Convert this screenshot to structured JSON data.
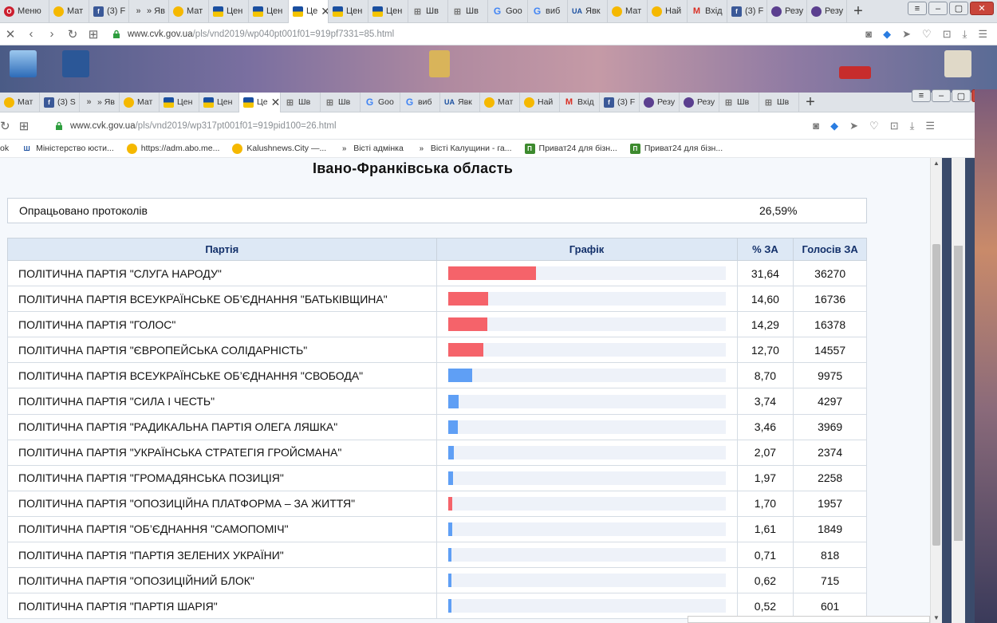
{
  "back_window": {
    "tabs": [
      {
        "label": "Меню",
        "icon": "opera-icon",
        "color": "#cc1f2f"
      },
      {
        "label": "Мат",
        "icon": "yellow-circle-icon",
        "color": "#f5b800"
      },
      {
        "label": "(3) F",
        "icon": "facebook-icon",
        "color": "#3b5998"
      },
      {
        "label": "» Яв",
        "icon": "page-icon",
        "color": "#666666"
      },
      {
        "label": "Мат",
        "icon": "yellow-circle-icon",
        "color": "#f5b800"
      },
      {
        "label": "Цен",
        "icon": "cvk-flag-icon",
        "color": "#1a4fa0"
      },
      {
        "label": "Цен",
        "icon": "cvk-flag-icon",
        "color": "#1a4fa0"
      },
      {
        "label": "Це",
        "icon": "cvk-flag-icon",
        "color": "#1a4fa0",
        "active": true
      },
      {
        "label": "Цен",
        "icon": "cvk-flag-icon",
        "color": "#1a4fa0"
      },
      {
        "label": "Цен",
        "icon": "cvk-flag-icon",
        "color": "#1a4fa0"
      },
      {
        "label": "Шв",
        "icon": "grid-icon",
        "color": "#777777"
      },
      {
        "label": "Шв",
        "icon": "grid-icon",
        "color": "#777777"
      },
      {
        "label": "Goo",
        "icon": "google-icon",
        "color": "#4285f4"
      },
      {
        "label": "виб",
        "icon": "google-icon",
        "color": "#4285f4"
      },
      {
        "label": "Явк",
        "icon": "ua-icon",
        "color": "#1a4fa0"
      },
      {
        "label": "Мат",
        "icon": "yellow-circle-icon",
        "color": "#f5b800"
      },
      {
        "label": "Най",
        "icon": "yellow-circle-icon",
        "color": "#f5b800"
      },
      {
        "label": "Вхід",
        "icon": "gmail-icon",
        "color": "#d93025"
      },
      {
        "label": "(3) F",
        "icon": "facebook-icon",
        "color": "#3b5998"
      },
      {
        "label": "Резу",
        "icon": "purple-circle-icon",
        "color": "#5b3f8f"
      },
      {
        "label": "Резу",
        "icon": "purple-circle-icon",
        "color": "#5b3f8f"
      }
    ],
    "url_host": "www.cvk.gov.ua",
    "url_path": "/pls/vnd2019/wp040pt001f01=919pf7331=85.html"
  },
  "front_window": {
    "tabs": [
      {
        "label": "Мат",
        "icon": "yellow-circle-icon",
        "color": "#f5b800"
      },
      {
        "label": "(3) S",
        "icon": "facebook-icon",
        "color": "#3b5998"
      },
      {
        "label": "» Яв",
        "icon": "page-icon",
        "color": "#666666"
      },
      {
        "label": "Мат",
        "icon": "yellow-circle-icon",
        "color": "#f5b800"
      },
      {
        "label": "Цен",
        "icon": "cvk-flag-icon",
        "color": "#1a4fa0"
      },
      {
        "label": "Цен",
        "icon": "cvk-flag-icon",
        "color": "#1a4fa0"
      },
      {
        "label": "Це",
        "icon": "cvk-flag-icon",
        "color": "#1a4fa0",
        "active": true
      },
      {
        "label": "Шв",
        "icon": "grid-icon",
        "color": "#777777"
      },
      {
        "label": "Шв",
        "icon": "grid-icon",
        "color": "#777777"
      },
      {
        "label": "Goo",
        "icon": "google-icon",
        "color": "#4285f4"
      },
      {
        "label": "виб",
        "icon": "google-icon",
        "color": "#4285f4"
      },
      {
        "label": "Явк",
        "icon": "ua-icon",
        "color": "#1a4fa0"
      },
      {
        "label": "Мат",
        "icon": "yellow-circle-icon",
        "color": "#f5b800"
      },
      {
        "label": "Най",
        "icon": "yellow-circle-icon",
        "color": "#f5b800"
      },
      {
        "label": "Вхід",
        "icon": "gmail-icon",
        "color": "#d93025"
      },
      {
        "label": "(3) F",
        "icon": "facebook-icon",
        "color": "#3b5998"
      },
      {
        "label": "Резу",
        "icon": "purple-circle-icon",
        "color": "#5b3f8f"
      },
      {
        "label": "Резу",
        "icon": "purple-circle-icon",
        "color": "#5b3f8f"
      },
      {
        "label": "Шв",
        "icon": "grid-icon",
        "color": "#777777"
      },
      {
        "label": "Шв",
        "icon": "grid-icon",
        "color": "#777777"
      }
    ],
    "url_host": "www.cvk.gov.ua",
    "url_path": "/pls/vnd2019/wp317pt001f01=919pid100=26.html",
    "bookmarks": [
      {
        "label": "ok",
        "icon": "none"
      },
      {
        "label": "Міністерство юсти...",
        "icon": "trident-icon",
        "color": "#1a4fa0"
      },
      {
        "label": "https://adm.abo.me...",
        "icon": "yellow-circle-icon",
        "color": "#f5b800"
      },
      {
        "label": "Kalushnews.City —...",
        "icon": "yellow-circle-icon",
        "color": "#f5b800"
      },
      {
        "label": "Вісті адмінка",
        "icon": "page-icon",
        "color": "#666666"
      },
      {
        "label": "Вісті Калущини - га...",
        "icon": "page-icon",
        "color": "#666666"
      },
      {
        "label": "Приват24 для бізн...",
        "icon": "privat-icon",
        "color": "#3d8a2e"
      },
      {
        "label": "Приват24 для бізн...",
        "icon": "privat-icon",
        "color": "#3d8a2e"
      }
    ]
  },
  "page": {
    "region_title": "Івано-Франківська область",
    "protocols_label": "Опрацьовано протоколів",
    "protocols_value": "26,59%",
    "headers": {
      "party": "Партія",
      "graph": "Графік",
      "pct": "% ЗА",
      "votes": "Голосів ЗА"
    },
    "colors": {
      "red_bar": "#f5636a",
      "blue_bar": "#5f9ff5",
      "track": "#eef2f9",
      "header_bg": "#dde8f5",
      "header_text": "#13306a"
    },
    "rows": [
      {
        "party": "ПОЛІТИЧНА ПАРТІЯ \"СЛУГА НАРОДУ\"",
        "pct": "31,64",
        "pct_value": 31.64,
        "votes": "36270",
        "bar": "red"
      },
      {
        "party": "ПОЛІТИЧНА ПАРТІЯ ВСЕУКРАЇНСЬКЕ ОБ’ЄДНАННЯ \"БАТЬКІВЩИНА\"",
        "pct": "14,60",
        "pct_value": 14.6,
        "votes": "16736",
        "bar": "red"
      },
      {
        "party": "ПОЛІТИЧНА ПАРТІЯ \"ГОЛОС\"",
        "pct": "14,29",
        "pct_value": 14.29,
        "votes": "16378",
        "bar": "red"
      },
      {
        "party": "ПОЛІТИЧНА ПАРТІЯ \"ЄВРОПЕЙСЬКА СОЛІДАРНІСТЬ\"",
        "pct": "12,70",
        "pct_value": 12.7,
        "votes": "14557",
        "bar": "red"
      },
      {
        "party": "ПОЛІТИЧНА ПАРТІЯ ВСЕУКРАЇНСЬКЕ ОБ’ЄДНАННЯ \"СВОБОДА\"",
        "pct": "8,70",
        "pct_value": 8.7,
        "votes": "9975",
        "bar": "blue"
      },
      {
        "party": "ПОЛІТИЧНА ПАРТІЯ \"СИЛА І ЧЕСТЬ\"",
        "pct": "3,74",
        "pct_value": 3.74,
        "votes": "4297",
        "bar": "blue"
      },
      {
        "party": "ПОЛІТИЧНА ПАРТІЯ \"РАДИКАЛЬНА ПАРТІЯ ОЛЕГА ЛЯШКА\"",
        "pct": "3,46",
        "pct_value": 3.46,
        "votes": "3969",
        "bar": "blue"
      },
      {
        "party": "ПОЛІТИЧНА ПАРТІЯ \"УКРАЇНСЬКА СТРАТЕГІЯ ГРОЙСМАНА\"",
        "pct": "2,07",
        "pct_value": 2.07,
        "votes": "2374",
        "bar": "blue"
      },
      {
        "party": "ПОЛІТИЧНА ПАРТІЯ \"ГРОМАДЯНСЬКА ПОЗИЦІЯ\"",
        "pct": "1,97",
        "pct_value": 1.97,
        "votes": "2258",
        "bar": "blue"
      },
      {
        "party": "ПОЛІТИЧНА ПАРТІЯ \"ОПОЗИЦІЙНА ПЛАТФОРМА – ЗА ЖИТТЯ\"",
        "pct": "1,70",
        "pct_value": 1.7,
        "votes": "1957",
        "bar": "red"
      },
      {
        "party": "ПОЛІТИЧНА ПАРТІЯ \"ОБ’ЄДНАННЯ \"САМОПОМІЧ\"",
        "pct": "1,61",
        "pct_value": 1.61,
        "votes": "1849",
        "bar": "blue"
      },
      {
        "party": "ПОЛІТИЧНА ПАРТІЯ \"ПАРТІЯ ЗЕЛЕНИХ УКРАЇНИ\"",
        "pct": "0,71",
        "pct_value": 0.71,
        "votes": "818",
        "bar": "blue"
      },
      {
        "party": "ПОЛІТИЧНА ПАРТІЯ \"ОПОЗИЦІЙНИЙ БЛОК\"",
        "pct": "0,62",
        "pct_value": 0.62,
        "votes": "715",
        "bar": "blue"
      },
      {
        "party": "ПОЛІТИЧНА ПАРТІЯ \"ПАРТІЯ ШАРІЯ\"",
        "pct": "0,52",
        "pct_value": 0.52,
        "votes": "601",
        "bar": "blue"
      }
    ]
  }
}
